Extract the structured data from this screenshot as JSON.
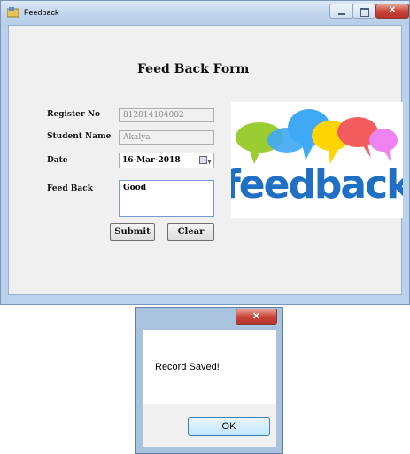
{
  "window": {
    "title": "Feedback"
  },
  "form": {
    "heading": "Feed Back Form",
    "register_no": {
      "label": "Register No",
      "value": "812814104002"
    },
    "student_name": {
      "label": "Student Name",
      "value": "Akalya"
    },
    "date": {
      "label": "Date",
      "value": "16-Mar-2018"
    },
    "feedback": {
      "label": "Feed Back",
      "value": "Good"
    },
    "submit_label": "Submit",
    "clear_label": "Clear"
  },
  "image": {
    "word": "feedback",
    "bubble_colors": [
      "#9acd32",
      "#3fa9f5",
      "#ffd400",
      "#f25c5c",
      "#ee82ee"
    ],
    "text_color": "#1f6fc5"
  },
  "dialog": {
    "message": "Record Saved!",
    "ok_label": "OK"
  }
}
